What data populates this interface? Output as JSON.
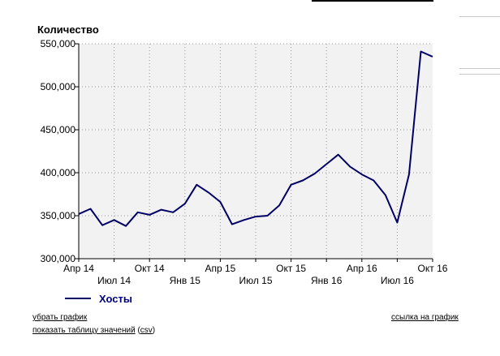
{
  "links": {
    "remove_chart": "убрать график",
    "show_table": "показать таблицу значений",
    "csv_open": " (",
    "csv": "csv",
    "csv_close": ")",
    "chart_link": "ссылка на график"
  },
  "colors": {
    "series": "#000066",
    "plot_background": "#f2f2f2",
    "grid": "#999999",
    "legend_text": "#000080"
  },
  "chart_data": {
    "type": "line",
    "title": "Количество",
    "xlabel": "",
    "ylabel": "",
    "ylim": [
      300000,
      550000
    ],
    "y_ticks": [
      300000,
      350000,
      400000,
      450000,
      500000,
      550000
    ],
    "y_tick_labels": [
      "300,000",
      "350,000",
      "400,000",
      "450,000",
      "500,000",
      "550,000"
    ],
    "x_ticks": [
      {
        "label": "Апр 14",
        "index": 0,
        "row": 1
      },
      {
        "label": "Июл 14",
        "index": 3,
        "row": 2
      },
      {
        "label": "Окт 14",
        "index": 6,
        "row": 1
      },
      {
        "label": "Янв 15",
        "index": 9,
        "row": 2
      },
      {
        "label": "Апр 15",
        "index": 12,
        "row": 1
      },
      {
        "label": "Июл 15",
        "index": 15,
        "row": 2
      },
      {
        "label": "Окт 15",
        "index": 18,
        "row": 1
      },
      {
        "label": "Янв 16",
        "index": 21,
        "row": 2
      },
      {
        "label": "Апр 16",
        "index": 24,
        "row": 1
      },
      {
        "label": "Июл 16",
        "index": 27,
        "row": 2
      },
      {
        "label": "Окт 16",
        "index": 30,
        "row": 1
      }
    ],
    "x_index_range": [
      0,
      30
    ],
    "grid": true,
    "legend_position": "bottom-left",
    "series": [
      {
        "name": "Хосты",
        "x": [
          0,
          1,
          2,
          3,
          4,
          5,
          6,
          7,
          8,
          9,
          10,
          11,
          12,
          13,
          14,
          15,
          16,
          17,
          18,
          19,
          20,
          21,
          22,
          23,
          24,
          25,
          26,
          27,
          28,
          29,
          30
        ],
        "values": [
          352000,
          358000,
          339000,
          345000,
          338000,
          354000,
          351000,
          357000,
          354000,
          364000,
          386000,
          377000,
          366000,
          340000,
          345000,
          349000,
          350000,
          362000,
          386000,
          391000,
          399000,
          410000,
          421000,
          407000,
          398000,
          391000,
          374000,
          342000,
          398000,
          541000,
          535000
        ]
      }
    ]
  }
}
